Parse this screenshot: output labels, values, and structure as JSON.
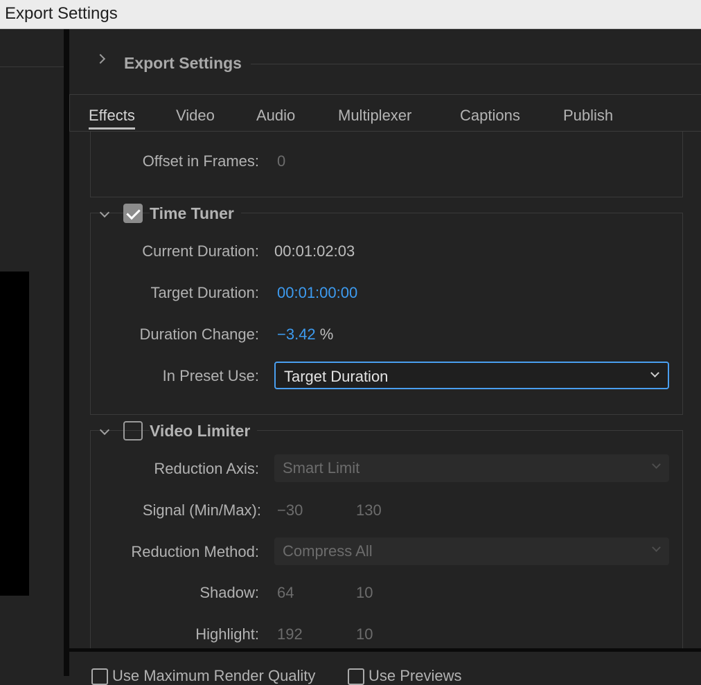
{
  "window": {
    "title": "Export Settings"
  },
  "section": {
    "title": "Export Settings"
  },
  "tabs": [
    "Effects",
    "Video",
    "Audio",
    "Multiplexer",
    "Captions",
    "Publish"
  ],
  "offset": {
    "label": "Offset in Frames:",
    "value": "0"
  },
  "time_tuner": {
    "title": "Time Tuner",
    "checked": true,
    "current_duration_label": "Current Duration:",
    "current_duration": "00:01:02:03",
    "target_duration_label": "Target Duration:",
    "target_duration": "00:01:00:00",
    "duration_change_label": "Duration Change:",
    "duration_change": "−3.42",
    "duration_change_unit": "%",
    "preset_use_label": "In Preset Use:",
    "preset_use_value": "Target Duration"
  },
  "video_limiter": {
    "title": "Video Limiter",
    "checked": false,
    "reduction_axis_label": "Reduction Axis:",
    "reduction_axis_value": "Smart Limit",
    "signal_label": "Signal (Min/Max):",
    "signal_min": "−30",
    "signal_max": "130",
    "reduction_method_label": "Reduction Method:",
    "reduction_method_value": "Compress All",
    "shadow_label": "Shadow:",
    "shadow_a": "64",
    "shadow_b": "10",
    "highlight_label": "Highlight:",
    "highlight_a": "192",
    "highlight_b": "10"
  },
  "bottom": {
    "max_render_label": "Use Maximum Render Quality",
    "use_previews_label": "Use Previews"
  },
  "colors": {
    "accent": "#3d9bf0",
    "background": "#232323"
  }
}
